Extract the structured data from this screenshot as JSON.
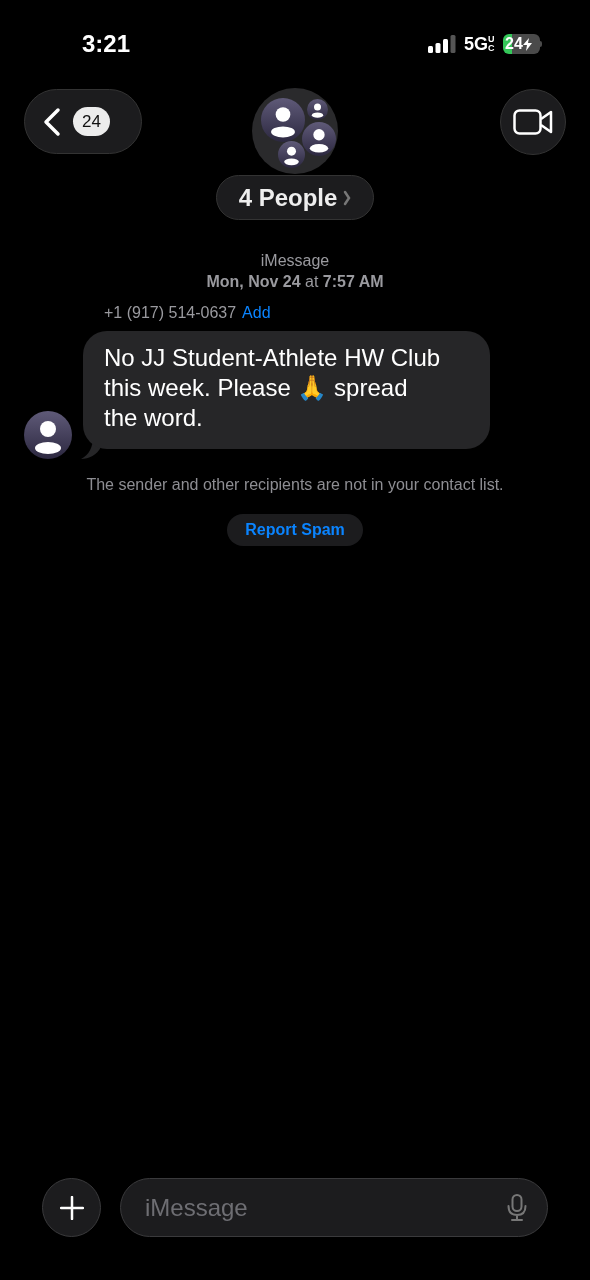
{
  "status_bar": {
    "time": "3:21",
    "network": "5G",
    "network_sub": "UC",
    "battery": "24"
  },
  "nav": {
    "back_count": "24",
    "title": "4 People"
  },
  "thread": {
    "service": "iMessage",
    "date": "Mon, Nov 24",
    "date_joiner": "at",
    "time": "7:57 AM",
    "sender": "+1 (917) 514-0637",
    "add_link": "Add",
    "message": "No JJ Student-Athlete HW Club this week. Please 🙏 spread the word.",
    "notice": "The sender and other recipients are not in your contact list.",
    "report_button": "Report Spam"
  },
  "composer": {
    "placeholder": "iMessage"
  }
}
